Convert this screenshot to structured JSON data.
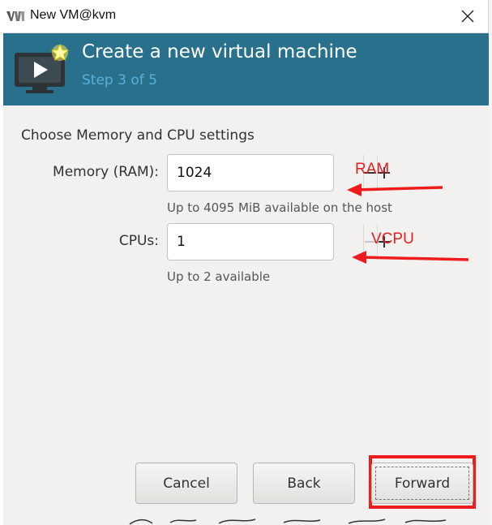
{
  "window": {
    "title": "New VM@kvm"
  },
  "header": {
    "title": "Create a new virtual machine",
    "step": "Step 3 of 5"
  },
  "section": {
    "title": "Choose Memory and CPU settings"
  },
  "memory": {
    "label": "Memory (RAM):",
    "value": "1024",
    "hint": "Up to 4095 MiB available on the host",
    "decrement_enabled": true
  },
  "cpus": {
    "label": "CPUs:",
    "value": "1",
    "hint": "Up to 2 available",
    "decrement_enabled": false
  },
  "annotations": {
    "ram": "RAM",
    "vcpu": "VCPU"
  },
  "buttons": {
    "cancel": "Cancel",
    "back": "Back",
    "forward": "Forward"
  },
  "colors": {
    "banner": "#29708c",
    "step_text": "#5ab0db",
    "annotation": "#e02020"
  }
}
